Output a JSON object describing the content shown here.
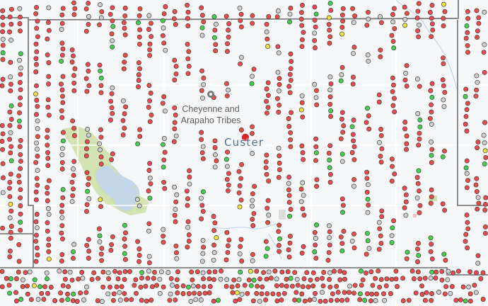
{
  "labels": {
    "tribe_area": [
      "Cheyenne and",
      "Arapaho Tribes"
    ],
    "county": "Custer"
  },
  "colors": {
    "background": "#f6f7f9",
    "county_line": "#7f7f7f",
    "road": "#ffffff",
    "water": "#c4d6e9",
    "park": "#cfe0aa",
    "well_red": "#ef4a4a",
    "well_gray": "#cfcfcf",
    "well_green": "#43d14a",
    "well_yellow": "#f3e53a",
    "county_seat": "#d9202b",
    "well_stroke": "#3a3a3a"
  },
  "icons": {
    "well_marker": "circle-marker",
    "county_seat": "city-dot",
    "landmark": "gray-pin-icon"
  }
}
